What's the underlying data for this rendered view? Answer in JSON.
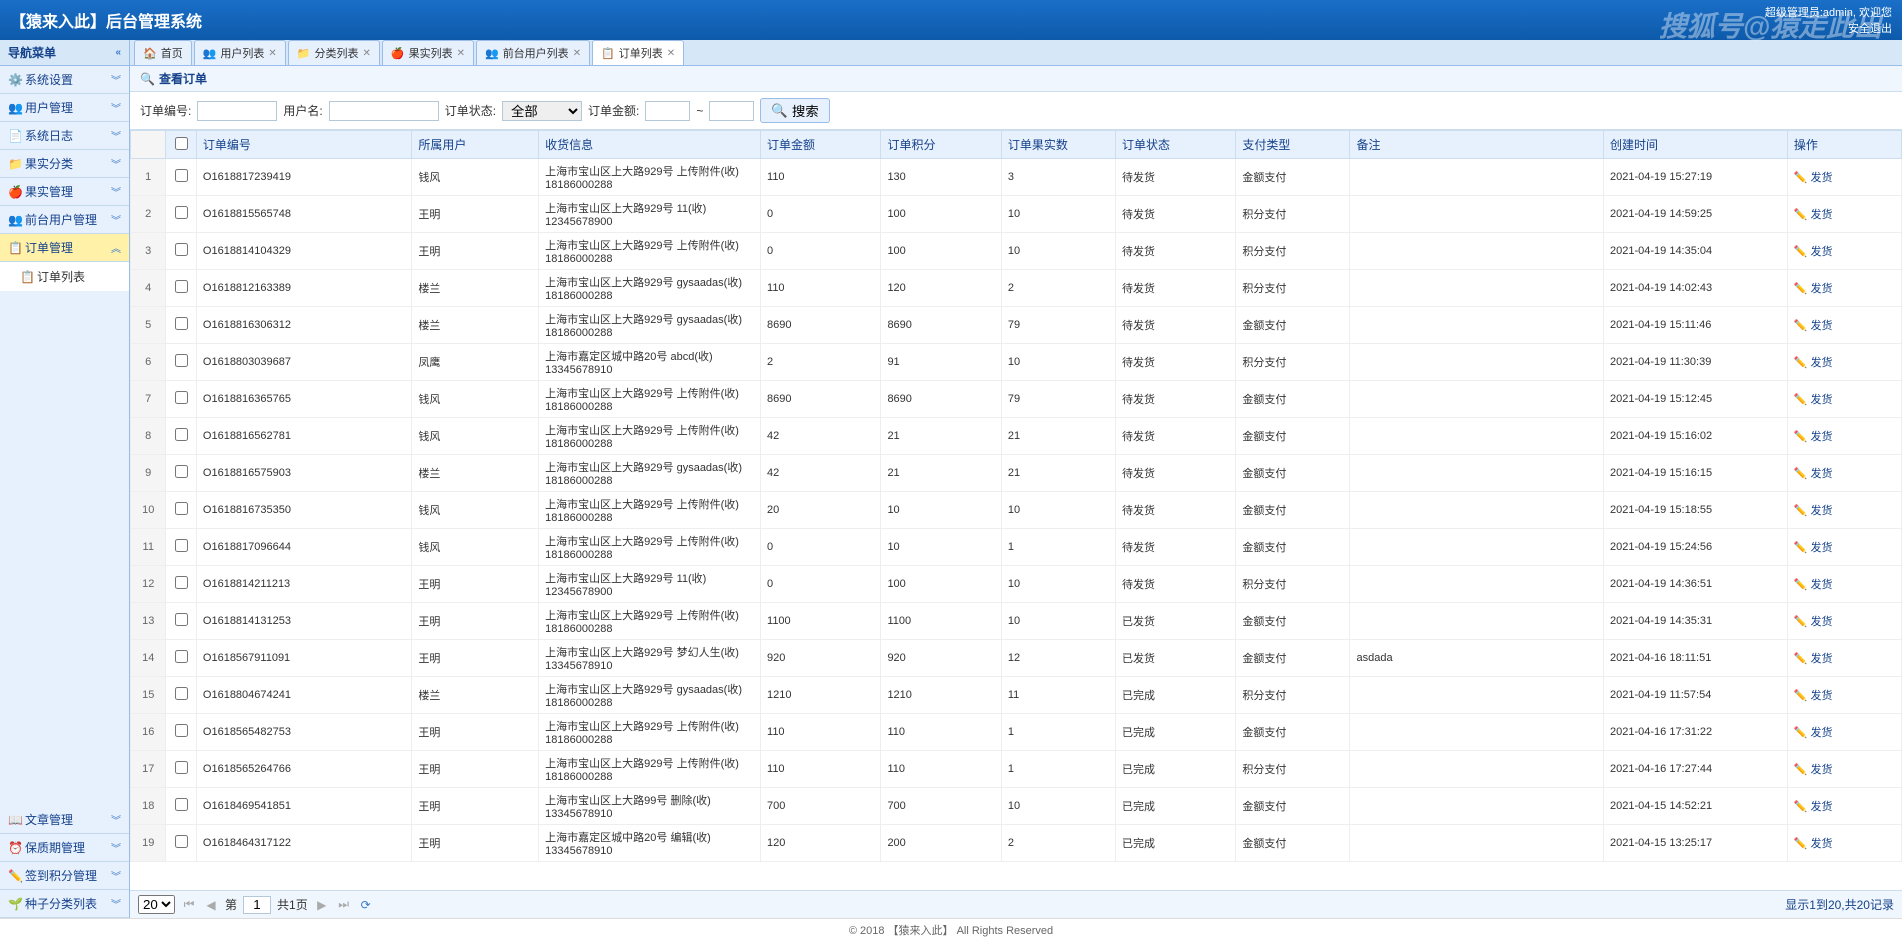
{
  "header": {
    "title": "【猿来入此】后台管理系统",
    "user_info": "超级管理员:admin, 欢迎您",
    "logout": "安全退出"
  },
  "watermark": "搜狐号@猿走此出",
  "sidebar": {
    "title": "导航菜单",
    "items": [
      {
        "label": "系统设置",
        "icon": "gear"
      },
      {
        "label": "用户管理",
        "icon": "users"
      },
      {
        "label": "系统日志",
        "icon": "log"
      },
      {
        "label": "果实分类",
        "icon": "category"
      },
      {
        "label": "果实管理",
        "icon": "fruit"
      },
      {
        "label": "前台用户管理",
        "icon": "users"
      },
      {
        "label": "订单管理",
        "icon": "clipboard",
        "active": true,
        "expanded": true
      }
    ],
    "sub_item": "订单列表",
    "bottom_items": [
      {
        "label": "文章管理",
        "icon": "book"
      },
      {
        "label": "保质期管理",
        "icon": "clock"
      },
      {
        "label": "签到积分管理",
        "icon": "pen"
      },
      {
        "label": "种子分类列表",
        "icon": "seed"
      }
    ]
  },
  "tabs": [
    {
      "label": "首页",
      "icon": "home",
      "closable": false
    },
    {
      "label": "用户列表",
      "icon": "users",
      "closable": true
    },
    {
      "label": "分类列表",
      "icon": "category",
      "closable": true
    },
    {
      "label": "果实列表",
      "icon": "fruit",
      "closable": true
    },
    {
      "label": "前台用户列表",
      "icon": "users",
      "closable": true
    },
    {
      "label": "订单列表",
      "icon": "clipboard",
      "closable": true,
      "active": true
    }
  ],
  "panel": {
    "title": "查看订单"
  },
  "search": {
    "order_id_label": "订单编号:",
    "username_label": "用户名:",
    "status_label": "订单状态:",
    "status_value": "全部",
    "amount_label": "订单金额:",
    "tilde": "~",
    "search_btn": "搜索"
  },
  "columns": [
    "订单编号",
    "所属用户",
    "收货信息",
    "订单金额",
    "订单积分",
    "订单果实数",
    "订单状态",
    "支付类型",
    "备注",
    "创建时间",
    "操作"
  ],
  "rows": [
    {
      "n": 1,
      "id": "O1618817239419",
      "user": "钱风",
      "addr": "上海市宝山区上大路929号 上传附件(收) 18186000288",
      "amt": "110",
      "pts": "130",
      "qty": "3",
      "status": "待发货",
      "pay": "金额支付",
      "note": "",
      "time": "2021-04-19 15:27:19",
      "act": "发货"
    },
    {
      "n": 2,
      "id": "O1618815565748",
      "user": "王明",
      "addr": "上海市宝山区上大路929号 11(收) 12345678900",
      "amt": "0",
      "pts": "100",
      "qty": "10",
      "status": "待发货",
      "pay": "积分支付",
      "note": "",
      "time": "2021-04-19 14:59:25",
      "act": "发货"
    },
    {
      "n": 3,
      "id": "O1618814104329",
      "user": "王明",
      "addr": "上海市宝山区上大路929号 上传附件(收) 18186000288",
      "amt": "0",
      "pts": "100",
      "qty": "10",
      "status": "待发货",
      "pay": "积分支付",
      "note": "",
      "time": "2021-04-19 14:35:04",
      "act": "发货"
    },
    {
      "n": 4,
      "id": "O1618812163389",
      "user": "楼兰",
      "addr": "上海市宝山区上大路929号 gysaadas(收) 18186000288",
      "amt": "110",
      "pts": "120",
      "qty": "2",
      "status": "待发货",
      "pay": "积分支付",
      "note": "",
      "time": "2021-04-19 14:02:43",
      "act": "发货"
    },
    {
      "n": 5,
      "id": "O1618816306312",
      "user": "楼兰",
      "addr": "上海市宝山区上大路929号 gysaadas(收) 18186000288",
      "amt": "8690",
      "pts": "8690",
      "qty": "79",
      "status": "待发货",
      "pay": "金额支付",
      "note": "",
      "time": "2021-04-19 15:11:46",
      "act": "发货"
    },
    {
      "n": 6,
      "id": "O1618803039687",
      "user": "凤鹰",
      "addr": "上海市嘉定区城中路20号 abcd(收) 13345678910",
      "amt": "2",
      "pts": "91",
      "qty": "10",
      "status": "待发货",
      "pay": "积分支付",
      "note": "",
      "time": "2021-04-19 11:30:39",
      "act": "发货"
    },
    {
      "n": 7,
      "id": "O1618816365765",
      "user": "钱风",
      "addr": "上海市宝山区上大路929号 上传附件(收) 18186000288",
      "amt": "8690",
      "pts": "8690",
      "qty": "79",
      "status": "待发货",
      "pay": "金额支付",
      "note": "",
      "time": "2021-04-19 15:12:45",
      "act": "发货"
    },
    {
      "n": 8,
      "id": "O1618816562781",
      "user": "钱风",
      "addr": "上海市宝山区上大路929号 上传附件(收) 18186000288",
      "amt": "42",
      "pts": "21",
      "qty": "21",
      "status": "待发货",
      "pay": "金额支付",
      "note": "",
      "time": "2021-04-19 15:16:02",
      "act": "发货"
    },
    {
      "n": 9,
      "id": "O1618816575903",
      "user": "楼兰",
      "addr": "上海市宝山区上大路929号 gysaadas(收) 18186000288",
      "amt": "42",
      "pts": "21",
      "qty": "21",
      "status": "待发货",
      "pay": "金额支付",
      "note": "",
      "time": "2021-04-19 15:16:15",
      "act": "发货"
    },
    {
      "n": 10,
      "id": "O1618816735350",
      "user": "钱风",
      "addr": "上海市宝山区上大路929号 上传附件(收) 18186000288",
      "amt": "20",
      "pts": "10",
      "qty": "10",
      "status": "待发货",
      "pay": "金额支付",
      "note": "",
      "time": "2021-04-19 15:18:55",
      "act": "发货"
    },
    {
      "n": 11,
      "id": "O1618817096644",
      "user": "钱风",
      "addr": "上海市宝山区上大路929号 上传附件(收) 18186000288",
      "amt": "0",
      "pts": "10",
      "qty": "1",
      "status": "待发货",
      "pay": "金额支付",
      "note": "",
      "time": "2021-04-19 15:24:56",
      "act": "发货"
    },
    {
      "n": 12,
      "id": "O1618814211213",
      "user": "王明",
      "addr": "上海市宝山区上大路929号 11(收) 12345678900",
      "amt": "0",
      "pts": "100",
      "qty": "10",
      "status": "待发货",
      "pay": "积分支付",
      "note": "",
      "time": "2021-04-19 14:36:51",
      "act": "发货"
    },
    {
      "n": 13,
      "id": "O1618814131253",
      "user": "王明",
      "addr": "上海市宝山区上大路929号 上传附件(收) 18186000288",
      "amt": "1100",
      "pts": "1100",
      "qty": "10",
      "status": "已发货",
      "pay": "金额支付",
      "note": "",
      "time": "2021-04-19 14:35:31",
      "act": "发货"
    },
    {
      "n": 14,
      "id": "O1618567911091",
      "user": "王明",
      "addr": "上海市宝山区上大路929号 梦幻人生(收) 13345678910",
      "amt": "920",
      "pts": "920",
      "qty": "12",
      "status": "已发货",
      "pay": "金额支付",
      "note": "asdada",
      "time": "2021-04-16 18:11:51",
      "act": "发货"
    },
    {
      "n": 15,
      "id": "O1618804674241",
      "user": "楼兰",
      "addr": "上海市宝山区上大路929号 gysaadas(收) 18186000288",
      "amt": "1210",
      "pts": "1210",
      "qty": "11",
      "status": "已完成",
      "pay": "积分支付",
      "note": "",
      "time": "2021-04-19 11:57:54",
      "act": "发货"
    },
    {
      "n": 16,
      "id": "O1618565482753",
      "user": "王明",
      "addr": "上海市宝山区上大路929号 上传附件(收) 18186000288",
      "amt": "110",
      "pts": "110",
      "qty": "1",
      "status": "已完成",
      "pay": "金额支付",
      "note": "",
      "time": "2021-04-16 17:31:22",
      "act": "发货"
    },
    {
      "n": 17,
      "id": "O1618565264766",
      "user": "王明",
      "addr": "上海市宝山区上大路929号 上传附件(收) 18186000288",
      "amt": "110",
      "pts": "110",
      "qty": "1",
      "status": "已完成",
      "pay": "积分支付",
      "note": "",
      "time": "2021-04-16 17:27:44",
      "act": "发货"
    },
    {
      "n": 18,
      "id": "O1618469541851",
      "user": "王明",
      "addr": "上海市宝山区上大路99号 删除(收) 13345678910",
      "amt": "700",
      "pts": "700",
      "qty": "10",
      "status": "已完成",
      "pay": "金额支付",
      "note": "",
      "time": "2021-04-15 14:52:21",
      "act": "发货"
    },
    {
      "n": 19,
      "id": "O1618464317122",
      "user": "王明",
      "addr": "上海市嘉定区城中路20号 编辑(收) 13345678910",
      "amt": "120",
      "pts": "200",
      "qty": "2",
      "status": "已完成",
      "pay": "金额支付",
      "note": "",
      "time": "2021-04-15 13:25:17",
      "act": "发货"
    }
  ],
  "pager": {
    "page_size": "20",
    "page_label_prefix": "第",
    "page": "1",
    "page_label_suffix": "共1页",
    "info": "显示1到20,共20记录"
  },
  "footer": "© 2018 【猿来入此】 All Rights Reserved"
}
